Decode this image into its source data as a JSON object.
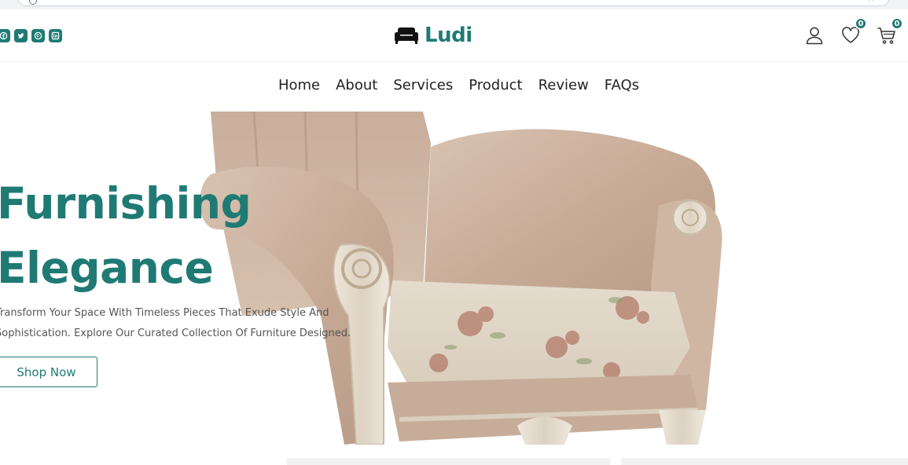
{
  "brand": {
    "name": "Ludi",
    "icon": "sofa-icon",
    "color": "#1f7a74"
  },
  "socials": [
    {
      "name": "facebook-icon"
    },
    {
      "name": "twitter-icon"
    },
    {
      "name": "pinterest-icon"
    },
    {
      "name": "linkedin-icon"
    }
  ],
  "header_actions": {
    "account_icon": "user-icon",
    "wishlist_icon": "heart-icon",
    "wishlist_count": "0",
    "cart_icon": "cart-icon",
    "cart_count": "0"
  },
  "nav": {
    "items": [
      "Home",
      "About",
      "Services",
      "Product",
      "Review",
      "FAQs"
    ]
  },
  "hero": {
    "title_line1": "Furnishing",
    "title_line2": "Elegance",
    "description": "Transform Your Space With Timeless Pieces That Exude Style And Sophistication. Explore Our Curated Collection Of Furniture Designed.",
    "cta_label": "Shop Now",
    "image": "armchair-image"
  }
}
